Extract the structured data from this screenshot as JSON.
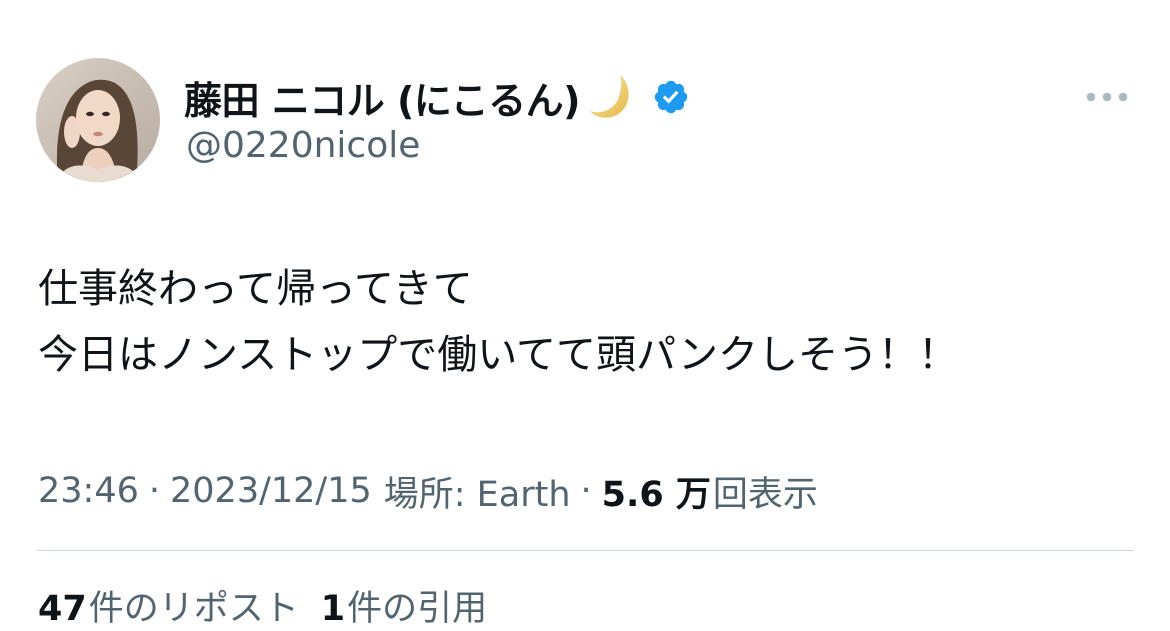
{
  "author": {
    "display_name": "藤田 ニコル (にこるん)",
    "handle": "@0220nicole",
    "avatar_icon": "profile-photo",
    "emoji_icon": "crescent-moon-icon",
    "verified_icon": "verified-badge-icon",
    "verified_color": "#1d9bf0"
  },
  "menu": {
    "icon": "more-options-icon"
  },
  "tweet": {
    "lines": [
      "仕事終わって帰ってきて",
      "今日はノンストップで働いてて頭パンクしそう！！"
    ]
  },
  "meta": {
    "time": "23:46",
    "separator": "·",
    "date": "2023/12/15",
    "location": "場所: Earth",
    "views_count": "5.6 万",
    "views_label": "回表示"
  },
  "stats": {
    "reposts_count": "47",
    "reposts_label": "件のリポスト",
    "quotes_count": "1",
    "quotes_label": "件の引用"
  },
  "colors": {
    "text_primary": "#0f1419",
    "text_secondary": "#536471",
    "divider": "#cfd9de"
  }
}
